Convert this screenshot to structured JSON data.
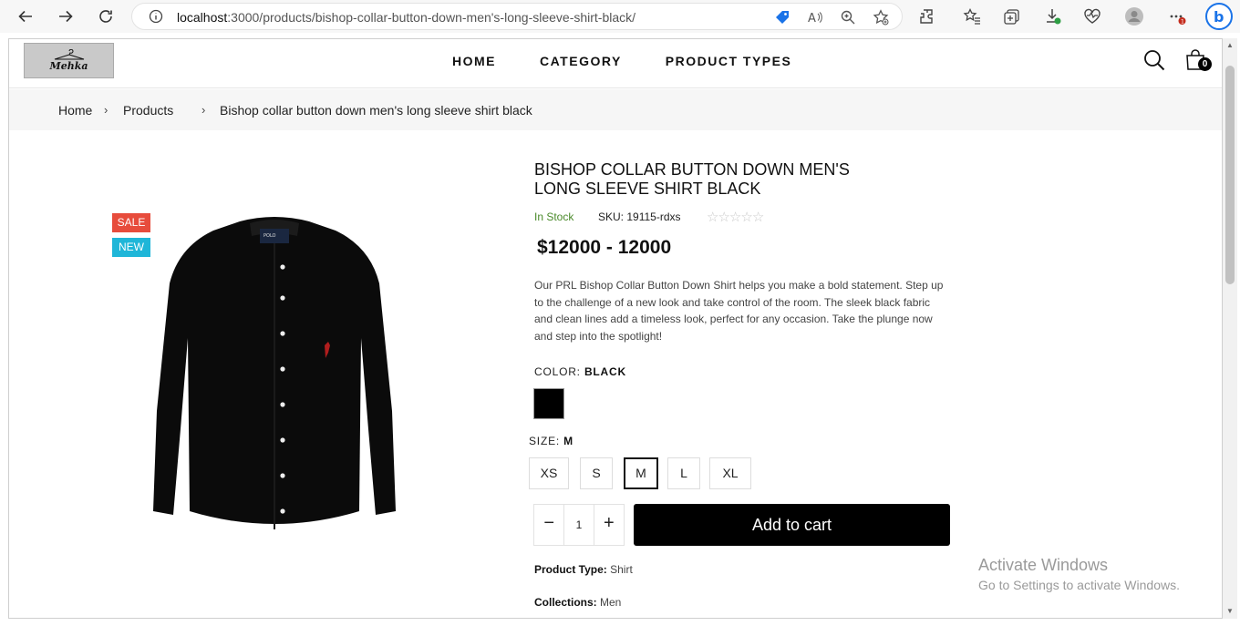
{
  "browser": {
    "url_host": "localhost",
    "url_path": ":3000/products/bishop-collar-button-down-men's-long-sleeve-shirt-black/"
  },
  "site": {
    "logo_text": "Mehka",
    "nav": [
      "HOME",
      "CATEGORY",
      "PRODUCT TYPES"
    ],
    "cart_count": "0"
  },
  "breadcrumb": {
    "home": "Home",
    "sep": "›",
    "products": "Products",
    "current": "Bishop collar button down men's long sleeve shirt black"
  },
  "product": {
    "badges": {
      "sale": "SALE",
      "new": "NEW"
    },
    "title": "BISHOP COLLAR BUTTON DOWN MEN'S LONG SLEEVE SHIRT BLACK",
    "stock": "In Stock",
    "sku_label": "SKU:",
    "sku": "19115-rdxs",
    "rating": 0,
    "price": "$12000 - 12000",
    "description": "Our PRL Bishop Collar Button Down Shirt helps you make a bold statement. Step up to the challenge of a new look and take control of the room. The sleek black fabric and clean lines add a timeless look, perfect for any occasion. Take the plunge now and step into the spotlight!",
    "color_label": "COLOR:",
    "color_value": "BLACK",
    "swatch_color": "#000000",
    "size_label": "SIZE:",
    "size_value": "M",
    "sizes": [
      "XS",
      "S",
      "M",
      "L",
      "XL"
    ],
    "quantity": "1",
    "qty_minus": "−",
    "qty_plus": "+",
    "add_to_cart": "Add to cart",
    "type_label": "Product Type:",
    "type_value": "Shirt",
    "collections_label": "Collections:",
    "collections_value": "Men"
  },
  "watermark": {
    "line1": "Activate Windows",
    "line2": "Go to Settings to activate Windows."
  }
}
